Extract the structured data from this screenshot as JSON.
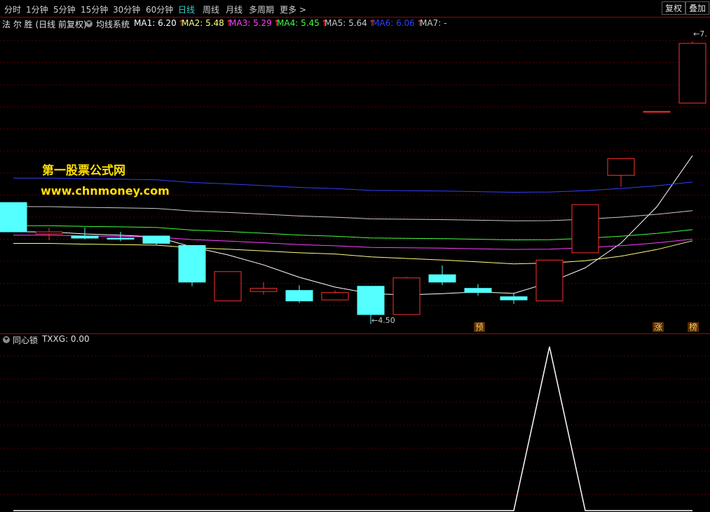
{
  "toolbar": {
    "periods": [
      "分时",
      "1分钟",
      "5分钟",
      "15分钟",
      "30分钟",
      "60分钟",
      "日线",
      "周线",
      "月线",
      "多周期",
      "更多 >"
    ],
    "active_index": 6,
    "buttons": [
      "复权",
      "叠加"
    ]
  },
  "info": {
    "stock_title": "法 尔 胜 (日线 前复权)",
    "indicator_name": "均线系统",
    "mas": [
      {
        "label": "MA1:",
        "value": "6.20",
        "color": "#ffffff"
      },
      {
        "label": "MA2:",
        "value": "5.48",
        "color": "#ffff80"
      },
      {
        "label": "MA3:",
        "value": "5.29",
        "color": "#ff40ff"
      },
      {
        "label": "MA4:",
        "value": "5.45",
        "color": "#40ff40"
      },
      {
        "label": "MA5:",
        "value": "5.64",
        "color": "#c8c8c8"
      },
      {
        "label": "MA6:",
        "value": "6.06",
        "color": "#3040ff"
      },
      {
        "label": "MA7:",
        "value": "-",
        "color": "#c8c8c8"
      }
    ],
    "arrow": "↑"
  },
  "watermark": {
    "line1": "第一股票公式网",
    "line2": "www.chnmoney.com"
  },
  "price_labels": {
    "high": "7.",
    "low": "4.50"
  },
  "badges": [
    "预",
    "涨",
    "榜"
  ],
  "indicator_pane": {
    "name": "同心锁",
    "series_label": "TXXG: 0.00"
  },
  "colors": {
    "up": "#ff3030",
    "down": "#54ffff",
    "grid": "#5a0000",
    "border": "#8a1010"
  },
  "candles": [
    {
      "o": 5.66,
      "h": 5.66,
      "l": 5.38,
      "c": 5.38
    },
    {
      "o": 5.36,
      "h": 5.42,
      "l": 5.3,
      "c": 5.38
    },
    {
      "o": 5.34,
      "h": 5.42,
      "l": 5.31,
      "c": 5.32
    },
    {
      "o": 5.32,
      "h": 5.38,
      "l": 5.29,
      "c": 5.31
    },
    {
      "o": 5.34,
      "h": 5.34,
      "l": 5.25,
      "c": 5.27
    },
    {
      "o": 5.25,
      "h": 5.25,
      "l": 4.86,
      "c": 4.9
    },
    {
      "o": 4.72,
      "h": 5.0,
      "l": 4.72,
      "c": 5.0
    },
    {
      "o": 4.81,
      "h": 4.9,
      "l": 4.78,
      "c": 4.84
    },
    {
      "o": 4.82,
      "h": 4.87,
      "l": 4.7,
      "c": 4.72
    },
    {
      "o": 4.73,
      "h": 4.82,
      "l": 4.73,
      "c": 4.8
    },
    {
      "o": 4.86,
      "h": 4.86,
      "l": 4.5,
      "c": 4.59
    },
    {
      "o": 4.59,
      "h": 4.95,
      "l": 4.59,
      "c": 4.94
    },
    {
      "o": 4.97,
      "h": 5.06,
      "l": 4.87,
      "c": 4.9
    },
    {
      "o": 4.84,
      "h": 4.88,
      "l": 4.77,
      "c": 4.8
    },
    {
      "o": 4.76,
      "h": 4.79,
      "l": 4.69,
      "c": 4.73
    },
    {
      "o": 4.72,
      "h": 5.11,
      "l": 4.72,
      "c": 5.11
    },
    {
      "o": 5.18,
      "h": 5.64,
      "l": 5.18,
      "c": 5.64
    },
    {
      "o": 5.92,
      "h": 6.08,
      "l": 5.81,
      "c": 6.08
    },
    {
      "o": 6.53,
      "h": 6.53,
      "l": 6.53,
      "c": 6.53
    },
    {
      "o": 6.61,
      "h": 7.2,
      "l": 6.61,
      "c": 7.18
    }
  ],
  "indicator_series": [
    0,
    0,
    0,
    0,
    0,
    0,
    0,
    0,
    0,
    0,
    0,
    0,
    0,
    0,
    0,
    1,
    0,
    0,
    0,
    0
  ]
}
